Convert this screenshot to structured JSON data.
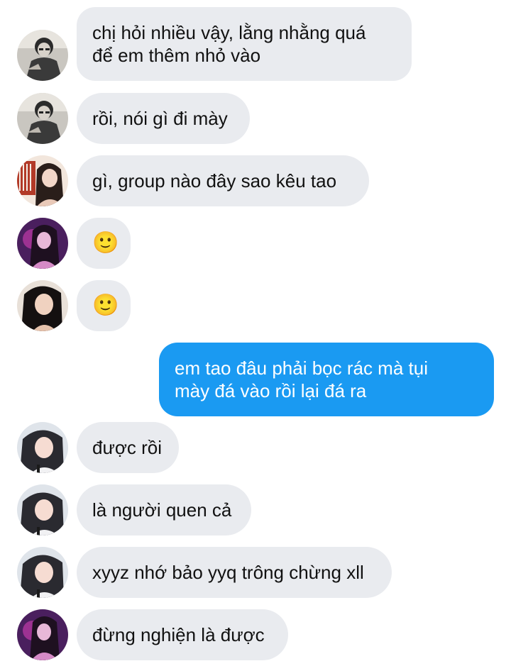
{
  "messages": [
    {
      "sender": "them",
      "avatar": "avatar-girl-bw-glasses",
      "lines": [
        "chị hỏi nhiều vậy, lằng nhằng quá",
        "để em thêm nhỏ vào"
      ]
    },
    {
      "sender": "them",
      "avatar": "avatar-girl-bw-glasses",
      "lines": [
        "rồi, nói gì đi mày"
      ]
    },
    {
      "sender": "them",
      "avatar": "avatar-girl-red-keyboard",
      "lines": [
        "gì, group nào đây sao kêu tao"
      ]
    },
    {
      "sender": "them",
      "avatar": "avatar-girl-purple",
      "emoji": "🙂"
    },
    {
      "sender": "them",
      "avatar": "avatar-girl-dark-hair",
      "emoji": "🙂"
    },
    {
      "sender": "me",
      "lines": [
        "em tao đâu phải bọc rác mà tụi",
        "mày đá vào rồi lại đá ra"
      ]
    },
    {
      "sender": "them",
      "avatar": "avatar-girl-long-hair",
      "lines": [
        "được rồi"
      ]
    },
    {
      "sender": "them",
      "avatar": "avatar-girl-long-hair",
      "lines": [
        "là người quen cả"
      ]
    },
    {
      "sender": "them",
      "avatar": "avatar-girl-long-hair",
      "lines": [
        "xyyz nhớ bảo yyq trông chừng xll"
      ]
    },
    {
      "sender": "them",
      "avatar": "avatar-girl-purple",
      "lines": [
        "đừng nghiện là được"
      ]
    }
  ],
  "colors": {
    "incoming_bubble": "#e9ebef",
    "outgoing_bubble": "#1a9af2",
    "incoming_text": "#111111",
    "outgoing_text": "#ffffff",
    "emoji": "#f2c200"
  }
}
